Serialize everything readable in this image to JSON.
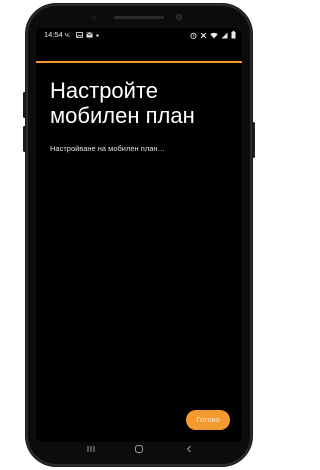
{
  "status_bar": {
    "time": "14:54 ч.",
    "left_icons": [
      "image-icon",
      "mail-icon",
      "dot-icon"
    ],
    "right_icons": [
      "alarm-icon",
      "data-saver-icon",
      "wifi-icon",
      "signal-icon",
      "battery-icon"
    ]
  },
  "progress": {
    "fraction": 1.0,
    "color": "#f39a2e"
  },
  "main": {
    "title": "Настройте мобилен план",
    "subtitle": "Настройване на мобилен план…"
  },
  "actions": {
    "done_label": "Готово"
  },
  "nav_bar": {
    "buttons": [
      "recents-icon",
      "home-icon",
      "back-icon"
    ]
  },
  "colors": {
    "accent": "#f39a2e",
    "screen_background": "#000000",
    "text_primary": "#ffffff"
  }
}
